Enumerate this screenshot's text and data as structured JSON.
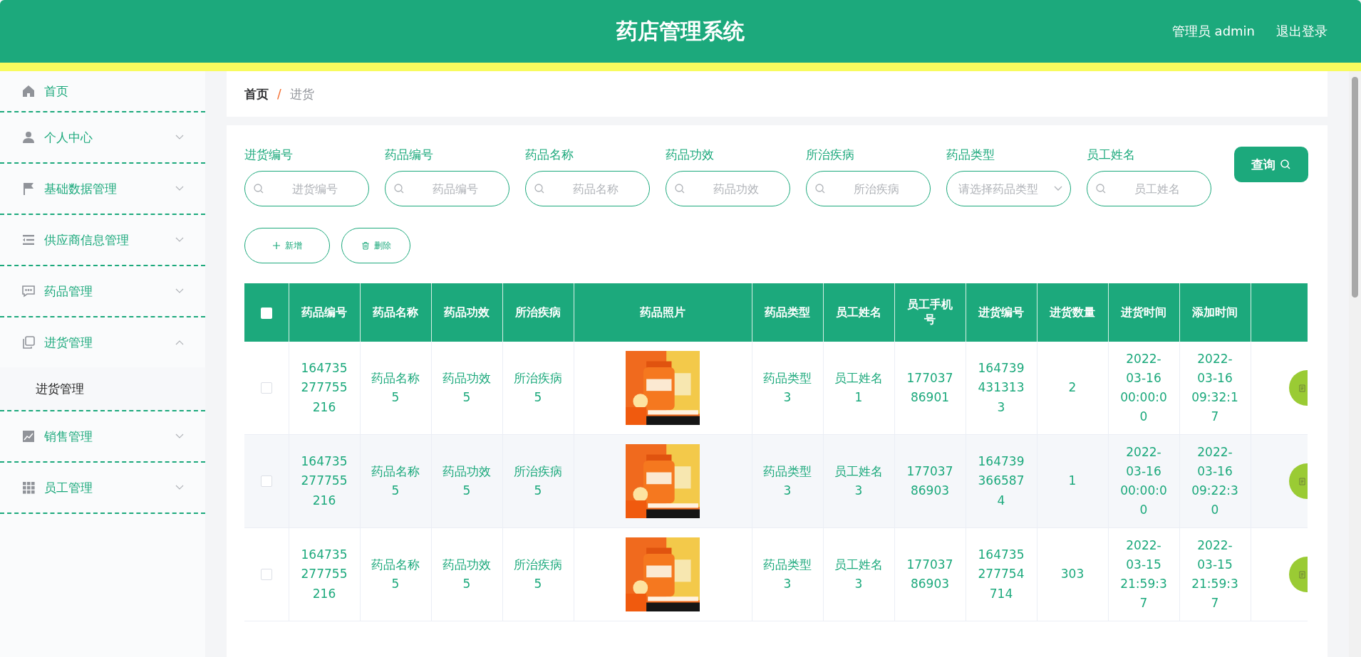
{
  "header": {
    "title": "药店管理系统",
    "user": "管理员 admin",
    "logout": "退出登录"
  },
  "sidebar": {
    "items": [
      {
        "label": "首页"
      },
      {
        "label": "个人中心",
        "expanded": false
      },
      {
        "label": "基础数据管理",
        "expanded": false
      },
      {
        "label": "供应商信息管理",
        "expanded": false
      },
      {
        "label": "药品管理",
        "expanded": false
      },
      {
        "label": "进货管理",
        "expanded": true,
        "children": [
          {
            "label": "进货管理"
          }
        ]
      },
      {
        "label": "销售管理",
        "expanded": false
      },
      {
        "label": "员工管理",
        "expanded": false
      }
    ]
  },
  "breadcrumb": {
    "items": [
      "首页",
      "进货"
    ],
    "separator": "/"
  },
  "filters": [
    {
      "label": "进货编号",
      "placeholder": "进货编号",
      "kind": "search"
    },
    {
      "label": "药品编号",
      "placeholder": "药品编号",
      "kind": "search"
    },
    {
      "label": "药品名称",
      "placeholder": "药品名称",
      "kind": "search"
    },
    {
      "label": "药品功效",
      "placeholder": "药品功效",
      "kind": "search"
    },
    {
      "label": "所治疾病",
      "placeholder": "所治疾病",
      "kind": "search"
    },
    {
      "label": "药品类型",
      "placeholder": "请选择药品类型",
      "kind": "select"
    },
    {
      "label": "员工姓名",
      "placeholder": "员工姓名",
      "kind": "search"
    }
  ],
  "query_button": "查询",
  "actions": [
    {
      "label": "新增",
      "kind": "add"
    },
    {
      "label": "删除",
      "kind": "delete"
    }
  ],
  "table": {
    "select_all": {
      "checked": false
    },
    "columns": [
      "药品编号",
      "药品名称",
      "药品功效",
      "所治疾病",
      "药品照片",
      "药品类型",
      "员工姓名",
      "员工手机号",
      "进货编号",
      "进货数量",
      "进货时间",
      "添加时间"
    ],
    "rows": [
      {
        "checked": false,
        "cells": [
          "164735277755216",
          "药品名称5",
          "药品功效5",
          "所治疾病5",
          {
            "kind": "picture"
          },
          "药品类型3",
          "员工姓名1",
          "17703786901",
          "1647394313133",
          "2",
          "2022-03-16 00:00:00",
          "2022-03-16 09:32:17"
        ]
      },
      {
        "checked": false,
        "cells": [
          "164735277755216",
          "药品名称5",
          "药品功效5",
          "所治疾病5",
          {
            "kind": "picture"
          },
          "药品类型3",
          "员工姓名3",
          "17703786903",
          "1647393665874",
          "1",
          "2022-03-16 00:00:00",
          "2022-03-16 09:22:30"
        ]
      },
      {
        "checked": false,
        "cells": [
          "164735277755216",
          "药品名称5",
          "药品功效5",
          "所治疾病5",
          {
            "kind": "picture"
          },
          "药品类型3",
          "员工姓名3",
          "17703786903",
          "164735277754714",
          "303",
          "2022-03-15 21:59:37",
          "2022-03-15 21:59:37"
        ]
      }
    ]
  }
}
